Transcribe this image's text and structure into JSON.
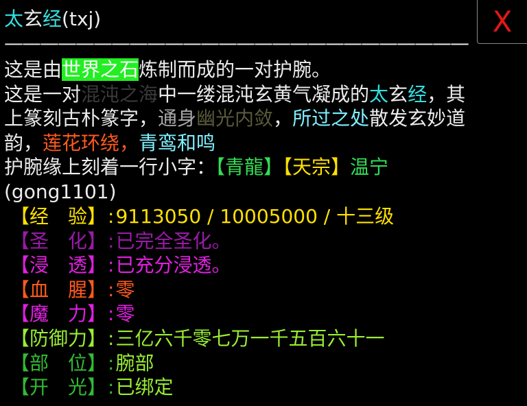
{
  "header": {
    "title_part1": "太",
    "title_part2": "玄",
    "title_part3": "经",
    "title_suffix": "(txj)",
    "close_label": "X",
    "divider": "——————————————————————————"
  },
  "description": {
    "line1_a": "这是由",
    "line1_highlight": "世界之石",
    "line1_b": "炼制而成的一对护腕。",
    "line2_a": "这是一对",
    "line2_dim": "混沌之海",
    "line2_b": "中一缕混沌玄黄气凝成的",
    "line2_name1": "太",
    "line2_name2": "玄",
    "line2_name3": "经",
    "line2_c": "，其",
    "line3_a": "上篆刻古朴篆字，",
    "line3_gray": "通身",
    "line3_dim": "幽光内敛",
    "line3_b": "，",
    "line3_cyan": "所过之处",
    "line3_c": "散发玄妙道",
    "line4_a": "韵，",
    "line4_orange": "莲花环绕，",
    "line4_cyan": "青鸾和鸣",
    "line5_a": "护腕缘上刻着一行小字：",
    "line5_tag1": "【青龍】",
    "line5_tag2": "【天宗】",
    "line5_tag3": "温宁",
    "line6": "(gong1101)"
  },
  "stats": [
    {
      "key": "【经　验】",
      "sep": ":",
      "value": "9113050 / 10005000 / 十三级",
      "key_color": "#ffe000",
      "value_color": "#ffe000"
    },
    {
      "key": "【圣　化】",
      "sep": ":",
      "value": "已完全圣化。",
      "key_color": "#9a1aa8",
      "value_color": "#9a1aa8"
    },
    {
      "key": "【浸　透】",
      "sep": ":",
      "value": "已充分浸透。",
      "key_color": "#e020e0",
      "value_color": "#e020e0"
    },
    {
      "key": "【血　腥】",
      "sep": ":",
      "value": "零",
      "key_color": "#ff5a1e",
      "value_color": "#ff5a1e"
    },
    {
      "key": "【魔　力】",
      "sep": ":",
      "value": "零",
      "key_color": "#e020e0",
      "value_color": "#e020e0"
    },
    {
      "key": "【防御力】",
      "sep": ":",
      "value": "三亿六千零七万一千五百六十一",
      "key_color": "#99ee33",
      "value_color": "#99ee33"
    },
    {
      "key": "【部　位】",
      "sep": ":",
      "value": "腕部",
      "key_color": "#33bb33",
      "value_color": "#99ee33"
    },
    {
      "key": "【开　光】",
      "sep": ":",
      "value": "已绑定",
      "key_color": "#33bb33",
      "value_color": "#99ee33"
    }
  ],
  "colors": {
    "background": "#000000",
    "close_x": "#e01818",
    "title_cyan": "#33e0e0",
    "highlight_bg": "#22ee22",
    "tag_green": "#33dd55",
    "tag_gold": "#ffe000"
  }
}
